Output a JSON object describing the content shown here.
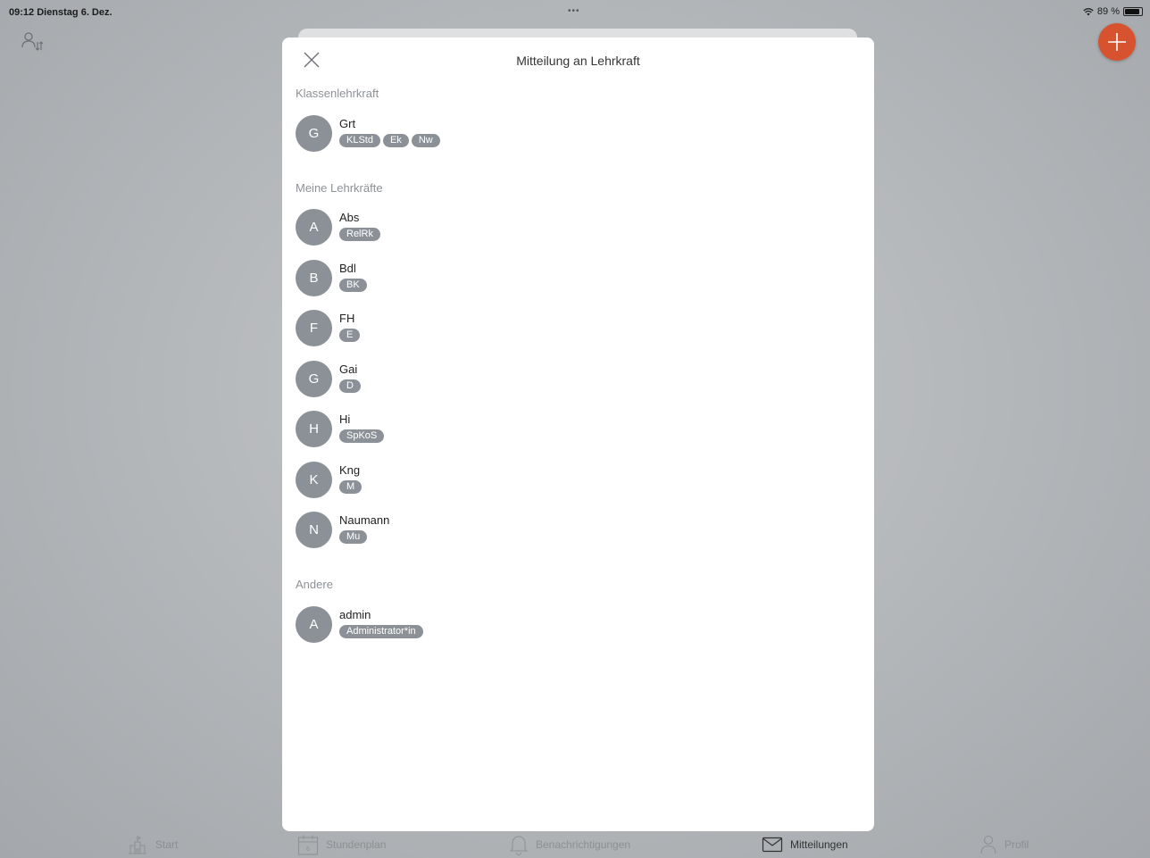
{
  "statusbar": {
    "time": "09:12  Dienstag 6. Dez.",
    "dots": "•••",
    "battery": "89 %"
  },
  "modal": {
    "title": "Mitteilung an Lehrkraft",
    "sections": [
      {
        "title": "Klassenlehrkraft",
        "teachers": [
          {
            "initial": "G",
            "name": "Grt",
            "tags": [
              "KLStd",
              "Ek",
              "Nw"
            ]
          }
        ]
      },
      {
        "title": "Meine Lehrkräfte",
        "teachers": [
          {
            "initial": "A",
            "name": "Abs",
            "tags": [
              "RelRk"
            ]
          },
          {
            "initial": "B",
            "name": "Bdl",
            "tags": [
              "BK"
            ]
          },
          {
            "initial": "F",
            "name": "FH",
            "tags": [
              "E"
            ]
          },
          {
            "initial": "G",
            "name": "Gai",
            "tags": [
              "D"
            ]
          },
          {
            "initial": "H",
            "name": "Hi",
            "tags": [
              "SpKoS"
            ]
          },
          {
            "initial": "K",
            "name": "Kng",
            "tags": [
              "M"
            ]
          },
          {
            "initial": "N",
            "name": "Naumann",
            "tags": [
              "Mu"
            ]
          }
        ]
      },
      {
        "title": "Andere",
        "teachers": [
          {
            "initial": "A",
            "name": "admin",
            "tags": [
              "Administrator*in"
            ]
          }
        ]
      }
    ]
  },
  "tabbar": {
    "start": "Start",
    "stundenplan": "Stundenplan",
    "benachrichtigungen": "Benachrichtigungen",
    "mitteilungen": "Mitteilungen",
    "profil": "Profil"
  },
  "colors": {
    "accent": "#d7532f",
    "avatar": "#8c9198",
    "section_title": "#8d9196"
  }
}
